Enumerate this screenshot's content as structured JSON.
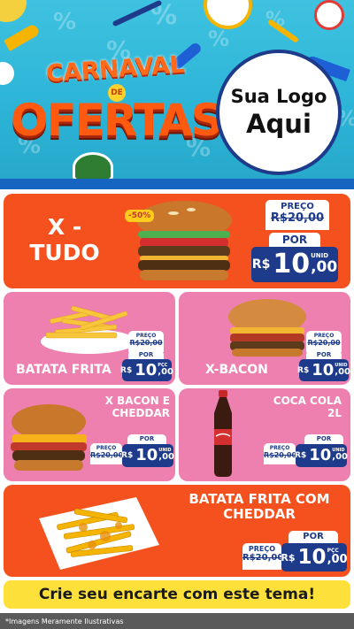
{
  "header": {
    "title_line1": "CARNAVAL",
    "title_connector": "DE",
    "title_line2": "OFERTAS",
    "logo_line1": "Sua Logo",
    "logo_line2": "Aqui"
  },
  "colors": {
    "orange": "#f4511e",
    "pink": "#ee80b0",
    "navy": "#1e3a8a",
    "yellow": "#fde13a",
    "sky": "#2bb3d6"
  },
  "products": {
    "xtudo": {
      "name": "X - TUDO",
      "badge": "-50%",
      "old_label": "PREÇO",
      "old_price": "R$20,00",
      "por_label": "POR",
      "currency": "R$",
      "price_int": "10",
      "price_cents": ",00",
      "unit": "UNID"
    },
    "batata": {
      "name": "BATATA FRITA",
      "old_label": "PREÇO",
      "old_price": "R$20,00",
      "por_label": "POR",
      "currency": "R$",
      "price_int": "10",
      "price_cents": ",00",
      "unit": "PÇC"
    },
    "xbacon": {
      "name": "X-BACON",
      "old_label": "PREÇO",
      "old_price": "R$20,00",
      "por_label": "POR",
      "currency": "R$",
      "price_int": "10",
      "price_cents": ",00",
      "unit": "UNID"
    },
    "xbacon_cheddar": {
      "name_line1": "X BACON E",
      "name_line2": "CHEDDAR",
      "old_label": "PREÇO",
      "old_price": "R$20,00",
      "por_label": "POR",
      "currency": "R$",
      "price_int": "10",
      "price_cents": ",00",
      "unit": "UNID"
    },
    "coca": {
      "name_line1": "COCA COLA",
      "name_line2": "2L",
      "old_label": "PREÇO",
      "old_price": "R$20,00",
      "por_label": "POR",
      "currency": "R$",
      "price_int": "10",
      "price_cents": ",00",
      "unit": "UNID"
    },
    "batata_cheddar": {
      "name_line1": "BATATA FRITA COM",
      "name_line2": "CHEDDAR",
      "old_label": "PREÇO",
      "old_price": "R$20,00",
      "por_label": "POR",
      "currency": "R$",
      "price_int": "10",
      "price_cents": ",00",
      "unit": "PÇC"
    }
  },
  "cta": "Crie seu encarte com este tema!",
  "footer": "*Imagens Meramente Ilustrativas"
}
